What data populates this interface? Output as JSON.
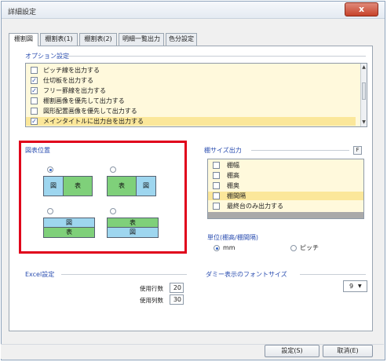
{
  "window": {
    "title": "詳細設定",
    "close_label": "x"
  },
  "tabs": [
    {
      "label": "棚割図"
    },
    {
      "label": "棚割表(1)"
    },
    {
      "label": "棚割表(2)"
    },
    {
      "label": "明細一覧出力"
    },
    {
      "label": "色分設定"
    }
  ],
  "options": {
    "title": "オプション設定",
    "items": [
      {
        "label": "ピッチ線を出力する",
        "checked": false
      },
      {
        "label": "仕切板を出力する",
        "checked": true
      },
      {
        "label": "フリー罫線を出力する",
        "checked": true
      },
      {
        "label": "棚割画像を優先して出力する",
        "checked": false
      },
      {
        "label": "図形配置画像を優先して出力する",
        "checked": false
      },
      {
        "label": "メインタイトルに出力台を出力する",
        "checked": true
      }
    ]
  },
  "layout": {
    "title": "図表位置",
    "fig_label": "図",
    "table_label": "表",
    "selected_index": 0
  },
  "shelf_size": {
    "title": "棚サイズ出力",
    "panel_button": "F",
    "items": [
      {
        "label": "棚幅",
        "checked": false
      },
      {
        "label": "棚高",
        "checked": false
      },
      {
        "label": "棚奥",
        "checked": false
      },
      {
        "label": "棚間隔",
        "checked": false
      },
      {
        "label": "最終台のみ出力する",
        "checked": false
      }
    ],
    "unit_title": "単位(棚高/棚間隔)",
    "unit_mm": "mm",
    "unit_pitch": "ピッチ"
  },
  "excel": {
    "title": "Excel設定",
    "rows_label": "使用行数",
    "rows_value": "20",
    "cols_label": "使用列数",
    "cols_value": "30"
  },
  "font": {
    "title": "ダミー表示のフォントサイズ",
    "value": "9"
  },
  "buttons": {
    "ok": "設定(S)",
    "cancel": "取消(E)"
  }
}
